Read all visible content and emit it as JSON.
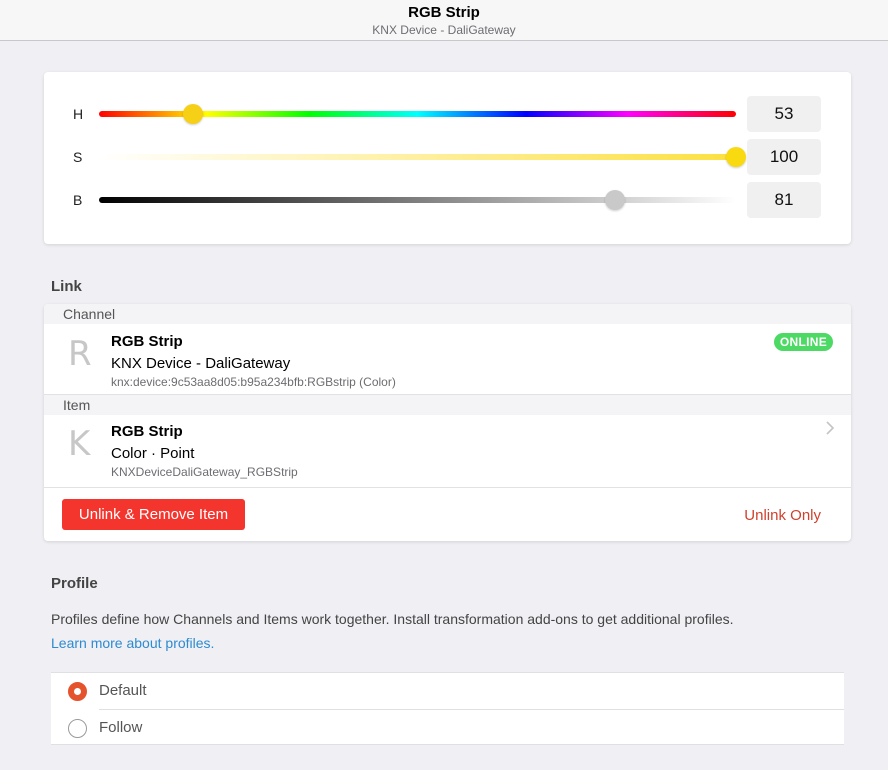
{
  "header": {
    "title": "RGB Strip",
    "subtitle": "KNX Device - DaliGateway"
  },
  "color": {
    "h": {
      "label": "H",
      "value": "53",
      "fraction": 0.147
    },
    "s": {
      "label": "S",
      "value": "100",
      "fraction": 1.0
    },
    "b": {
      "label": "B",
      "value": "81",
      "fraction": 0.81
    }
  },
  "link": {
    "section_title": "Link",
    "channel": {
      "header": "Channel",
      "avatar": "R",
      "title": "RGB Strip",
      "subtitle": "KNX Device - DaliGateway",
      "uid": "knx:device:9c53aa8d05:b95a234bfb:RGBstrip (Color)",
      "status": "ONLINE",
      "status_color": "#4cd964"
    },
    "item": {
      "header": "Item",
      "avatar": "K",
      "title": "RGB Strip",
      "subtitle": "Color · Point",
      "name": "KNXDeviceDaliGateway_RGBStrip"
    },
    "unlink_remove_label": "Unlink & Remove Item",
    "unlink_only_label": "Unlink Only"
  },
  "profile": {
    "section_title": "Profile",
    "description": "Profiles define how Channels and Items work together. Install transformation add-ons to get additional profiles.",
    "learn_more": "Learn more about profiles.",
    "options": [
      {
        "label": "Default",
        "selected": true
      },
      {
        "label": "Follow",
        "selected": false
      }
    ]
  },
  "colors": {
    "accent": "#e4532c",
    "danger": "#f4352e",
    "link": "#2d8bd1"
  }
}
